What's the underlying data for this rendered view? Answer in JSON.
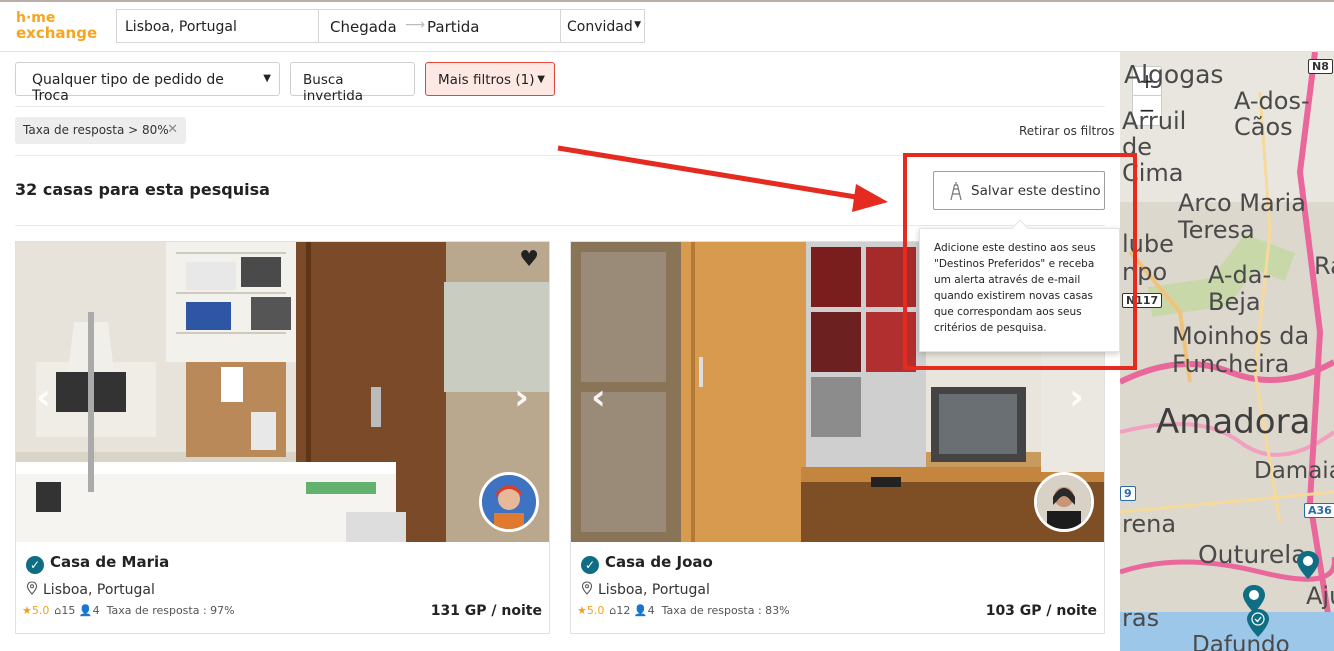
{
  "header": {
    "logo_line1": "h·me",
    "logo_line2": "exchange",
    "location": "Lisboa, Portugal",
    "arrival": "Chegada",
    "departure": "Partida",
    "guests": "Convidad"
  },
  "filters": {
    "exchange_type": "Qualquer tipo de pedido de Troca",
    "reverse_search": "Busca invertida",
    "more_filters": "Mais filtros (1)",
    "active_chip": "Taxa de resposta > 80%",
    "clear_filters": "Retirar os filtros"
  },
  "results": {
    "count_label": "32 casas para esta pesquisa",
    "save_destination": "Salvar este destino",
    "tooltip": "Adicione este destino aos seus \"Destinos Preferidos\" e receba um alerta através de e-mail quando existirem novas casas que correspondam aos seus critérios de pesquisa."
  },
  "listings": [
    {
      "title": "Casa de Maria",
      "location": "Lisboa, Portugal",
      "rating": "5.0",
      "home_count": "15",
      "guests": "4",
      "response_rate": "Taxa de resposta : 97%",
      "price": "131 GP / noite"
    },
    {
      "title": "Casa de Joao",
      "location": "Lisboa, Portugal",
      "rating": "5.0",
      "home_count": "12",
      "guests": "4",
      "response_rate": "Taxa de resposta : 83%",
      "price": "103 GP / noite"
    }
  ],
  "map": {
    "zoom_in": "+",
    "zoom_out": "−",
    "labels": [
      "Algogas",
      "A-dos-Cãos",
      "Arruil de Cima",
      "Arco Maria Teresa",
      "lube",
      "npo",
      "A-da-Beja",
      "Moinhos da Funcheira",
      "Amadora",
      "Damaia",
      "rena",
      "Outurela",
      "Aju",
      "ras",
      "Dafundo",
      "Ra"
    ],
    "road_labels": [
      "N8",
      "N117",
      "A36",
      "9"
    ]
  },
  "colors": {
    "brand": "#f7a51f",
    "accent_teal": "#0f6e84",
    "filter_active": "#e0483d",
    "annotation_red": "#e52b20"
  }
}
